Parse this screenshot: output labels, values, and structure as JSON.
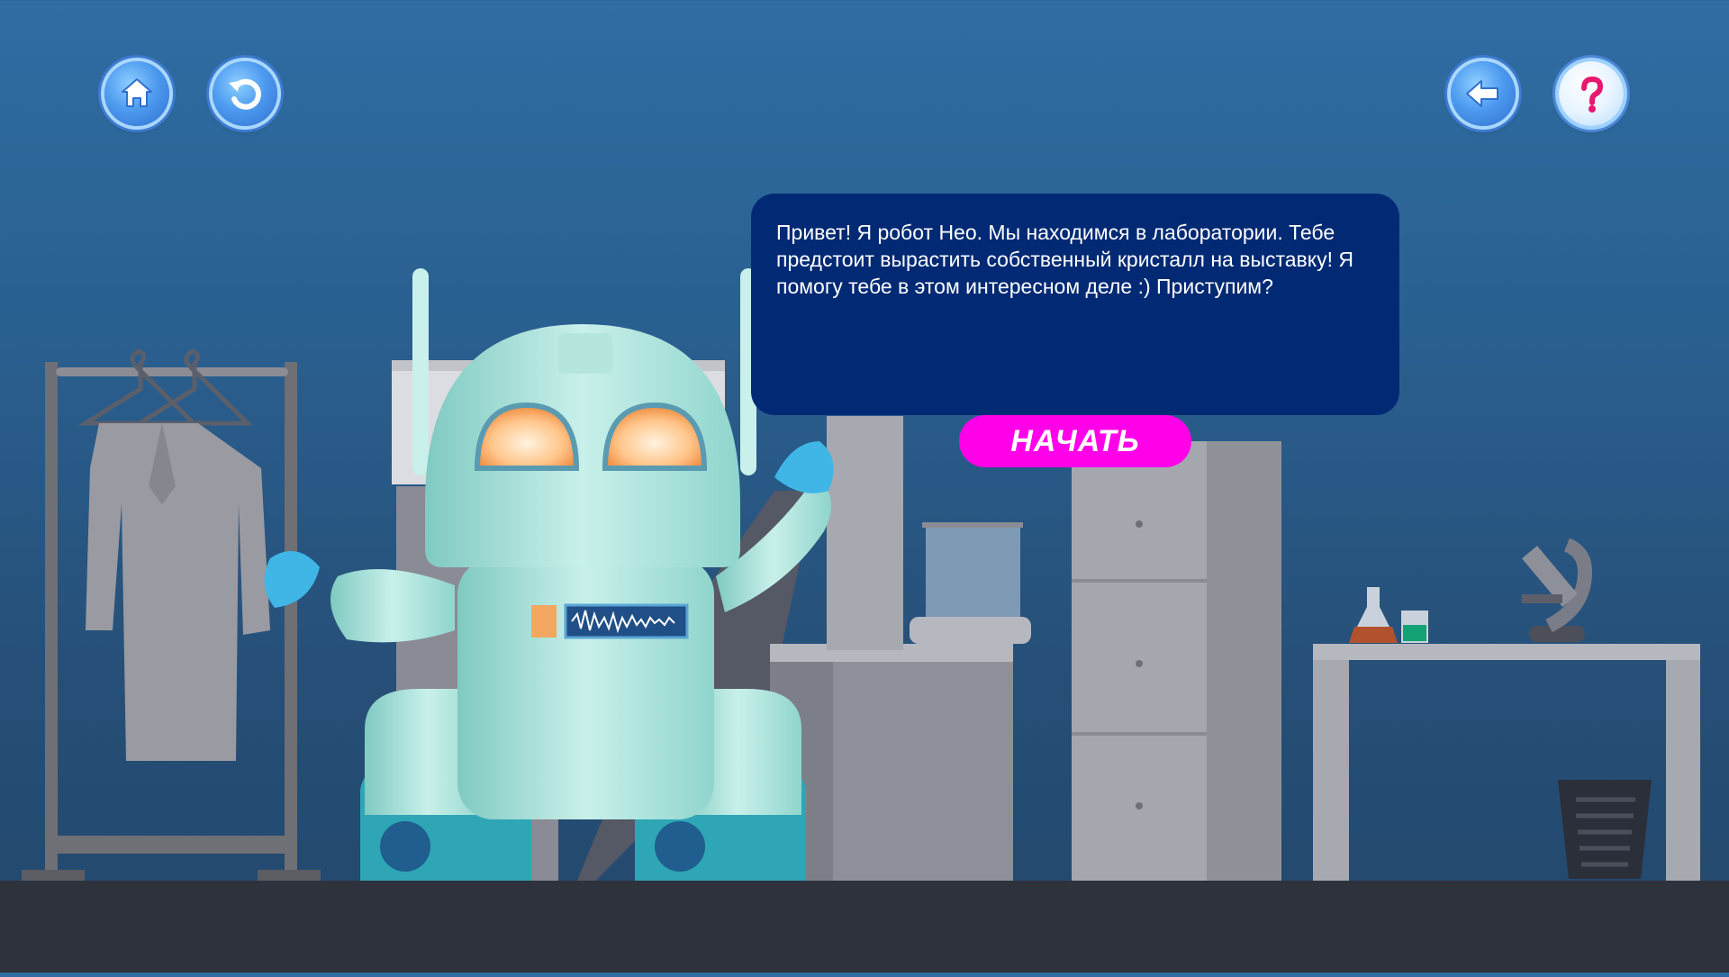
{
  "nav": {
    "home": "home-icon",
    "restart": "restart-icon",
    "back": "back-arrow-icon",
    "help": "help-icon"
  },
  "dialog": {
    "text": "Привет! Я робот Нео. Мы находимся в лаборатории. Тебе предстоит вырастить собственный кристалл на выставку! Я помогу тебе в этом интересном деле :) Приступим?"
  },
  "start_button": {
    "label": "НАЧАТЬ"
  },
  "colors": {
    "dialog_bg": "#022a74",
    "start_button": "#ff00e8",
    "nav_button": "#4e9bf0",
    "help_mark": "#e8176f"
  }
}
